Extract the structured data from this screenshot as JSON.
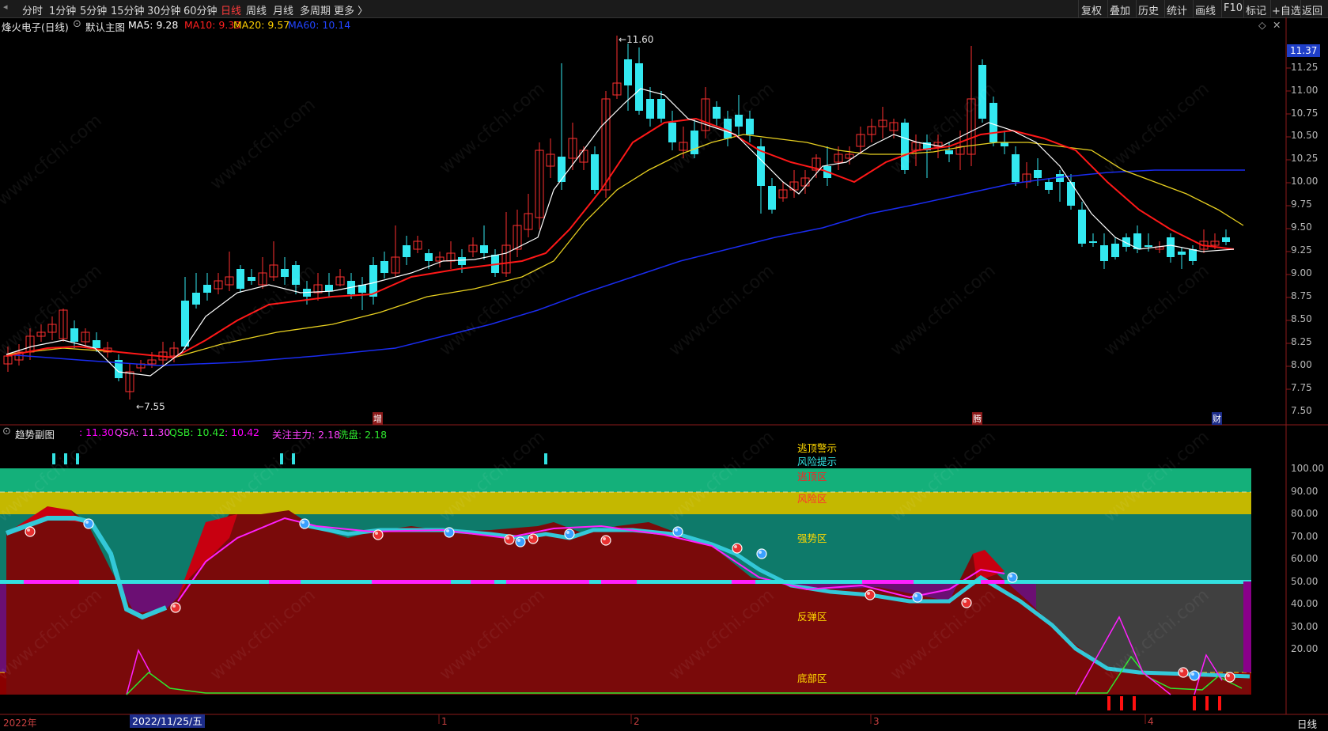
{
  "toolbar": {
    "periods": [
      "分时",
      "1分钟",
      "5分钟",
      "15分钟",
      "30分钟",
      "60分钟",
      "日线",
      "周线",
      "月线",
      "多周期",
      "更多 〉"
    ],
    "active_period": "日线",
    "right_buttons": [
      "复权",
      "叠加",
      "历史",
      "统计",
      "画线",
      "F10",
      "标记",
      "+自选",
      "返回"
    ]
  },
  "main_chart": {
    "stock_title": "烽火电子(日线)",
    "indicator_name": "默认主图",
    "ma": [
      {
        "label": "MA5: 9.28",
        "color": "#ffffff"
      },
      {
        "label": "MA10: 9.33",
        "color": "#ff2020"
      },
      {
        "label": "MA20: 9.57",
        "color": "#ffd000"
      },
      {
        "label": "MA60: 10.14",
        "color": "#2244ff"
      }
    ],
    "current_price": "11.37",
    "y_ticks": [
      "11.25",
      "11.00",
      "10.75",
      "10.50",
      "10.25",
      "10.00",
      "9.75",
      "9.50",
      "9.25",
      "9.00",
      "8.75",
      "8.50",
      "8.25",
      "8.00",
      "7.75",
      "7.50"
    ],
    "high_annotation": "11.60",
    "low_annotation": "7.55",
    "event_markers": [
      "增",
      "腾",
      "财"
    ]
  },
  "sub_chart": {
    "indicator_name": "趋势副图",
    "values": [
      {
        "label": ": 11.30",
        "color": "#ff00ff"
      },
      {
        "label": "QSA: 11.30",
        "color": "#ff40ff"
      },
      {
        "label": "QSB: 10.42",
        "color": "#2ee82e"
      },
      {
        "label": ": 10.42",
        "color": "#ff00ff"
      },
      {
        "label": "关注主力: 2.18",
        "color": "#ff40ff"
      },
      {
        "label": "洗盘: 2.18",
        "color": "#2ee82e"
      }
    ],
    "y_ticks": [
      "100.00",
      "90.00",
      "80.00",
      "70.00",
      "60.00",
      "50.00",
      "40.00",
      "30.00",
      "20.00"
    ],
    "zones": {
      "escape_warning": "逃顶警示",
      "risk_hint": "风险提示",
      "escape_zone": "逃顶区",
      "risk_zone": "风险区",
      "strong_zone": "强势区",
      "rebound_zone": "反弹区",
      "bottom_zone": "底部区"
    }
  },
  "x_axis": {
    "year_label": "2022年",
    "cursor_date": "2022/11/25/五",
    "month_labels": [
      "1",
      "2",
      "3",
      "4"
    ],
    "period_label": "日线"
  },
  "watermark": "www.cfchi.com"
}
